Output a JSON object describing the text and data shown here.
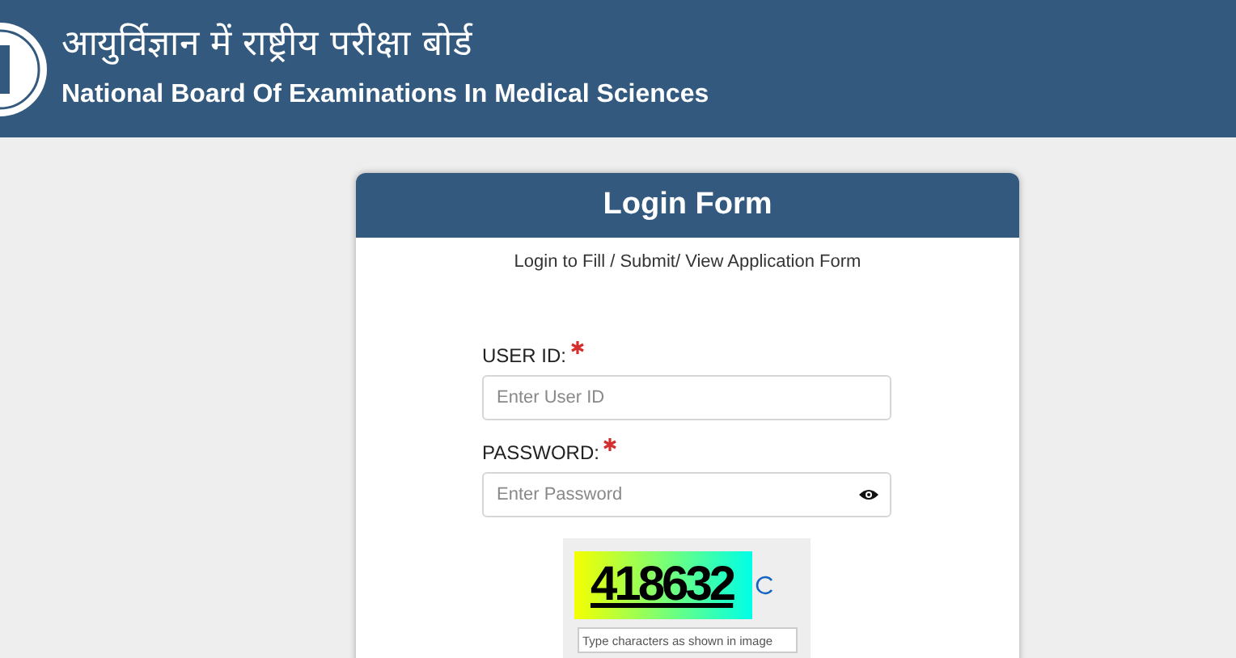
{
  "header": {
    "title_hindi": "आयुर्विज्ञान में राष्ट्रीय परीक्षा बोर्ड",
    "title": "National Board Of Examinations In Medical Sciences"
  },
  "login_form": {
    "title": "Login Form",
    "subtitle": "Login to Fill / Submit/ View Application Form",
    "fields": [
      {
        "label": "USER ID:",
        "required": true,
        "placeholder": "Enter User ID",
        "kind": "text"
      },
      {
        "label": "PASSWORD:",
        "required": true,
        "placeholder": "Enter Password",
        "kind": "password"
      }
    ],
    "captcha": {
      "code": "418632",
      "placeholder": "Type characters as shown in image"
    }
  }
}
